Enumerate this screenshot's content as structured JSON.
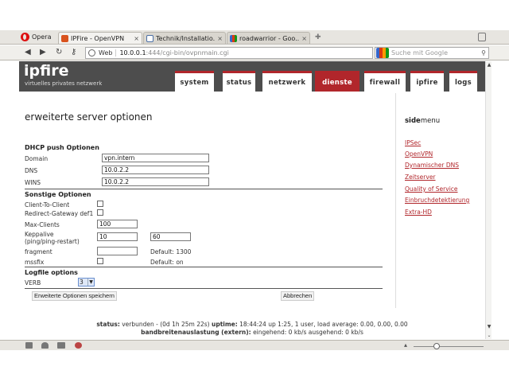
{
  "browser": {
    "menu_label": "Opera",
    "tabs": [
      {
        "title": "IPFire - OpenVPN",
        "active": true
      },
      {
        "title": "Technik/Installatio...",
        "active": false
      },
      {
        "title": "roadwarrior - Goo...",
        "active": false
      }
    ],
    "address": {
      "mode": "Web",
      "host": "10.0.0.1",
      "path": ":444/cgi-bin/ovpnmain.cgi"
    },
    "search_placeholder": "Suche mit Google"
  },
  "header": {
    "brand": "ipfire",
    "tagline": "virtuelles privates netzwerk",
    "nav": [
      "system",
      "status",
      "netzwerk",
      "dienste",
      "firewall",
      "ipfire",
      "logs"
    ],
    "active_nav": "dienste"
  },
  "page_title": "erweiterte server optionen",
  "sidemenu": {
    "title_bold": "side",
    "title_rest": "menu",
    "items": [
      "IPSec",
      "OpenVPN",
      "Dynamischer DNS",
      "Zeitserver",
      "Quality of Service",
      "Einbruchdetektierung",
      "Extra-HD"
    ]
  },
  "dhcp": {
    "heading": "DHCP push Optionen",
    "domain_label": "Domain",
    "domain_value": "vpn.intern",
    "dns_label": "DNS",
    "dns_value": "10.0.2.2",
    "wins_label": "WINS",
    "wins_value": "10.0.2.2"
  },
  "other": {
    "heading": "Sonstige Optionen",
    "client_to_client": "Client-To-Client",
    "redirect_gateway": "Redirect-Gateway def1",
    "max_clients_label": "Max-Clients",
    "max_clients_value": "100",
    "keepalive_label": "Keppalive",
    "keepalive_sub": "(ping/ping-restart)",
    "keepalive_ping": "10",
    "keepalive_restart": "60",
    "fragment_label": "fragment",
    "fragment_default": "Default: 1300",
    "mssfix_label": "mssfix",
    "mssfix_default": "Default: on"
  },
  "log": {
    "heading": "Logfile options",
    "verb_label": "VERB",
    "verb_value": "3"
  },
  "buttons": {
    "save": "Erweiterte Optionen speichern",
    "cancel": "Abbrechen"
  },
  "status": {
    "status_label": "status:",
    "status_text": "verbunden - (0d 1h 25m 22s)",
    "uptime_label": "uptime:",
    "uptime_text": "18:44:24 up 1:25, 1 user, load average: 0.00, 0.00, 0.00",
    "bw_label": "bandbreitenauslastung (extern):",
    "bw_text": "eingehend: 0 kb/s ausgehend: 0 kb/s"
  },
  "colors": {
    "accent": "#b1262b",
    "header_bg": "#4d4d4d"
  }
}
